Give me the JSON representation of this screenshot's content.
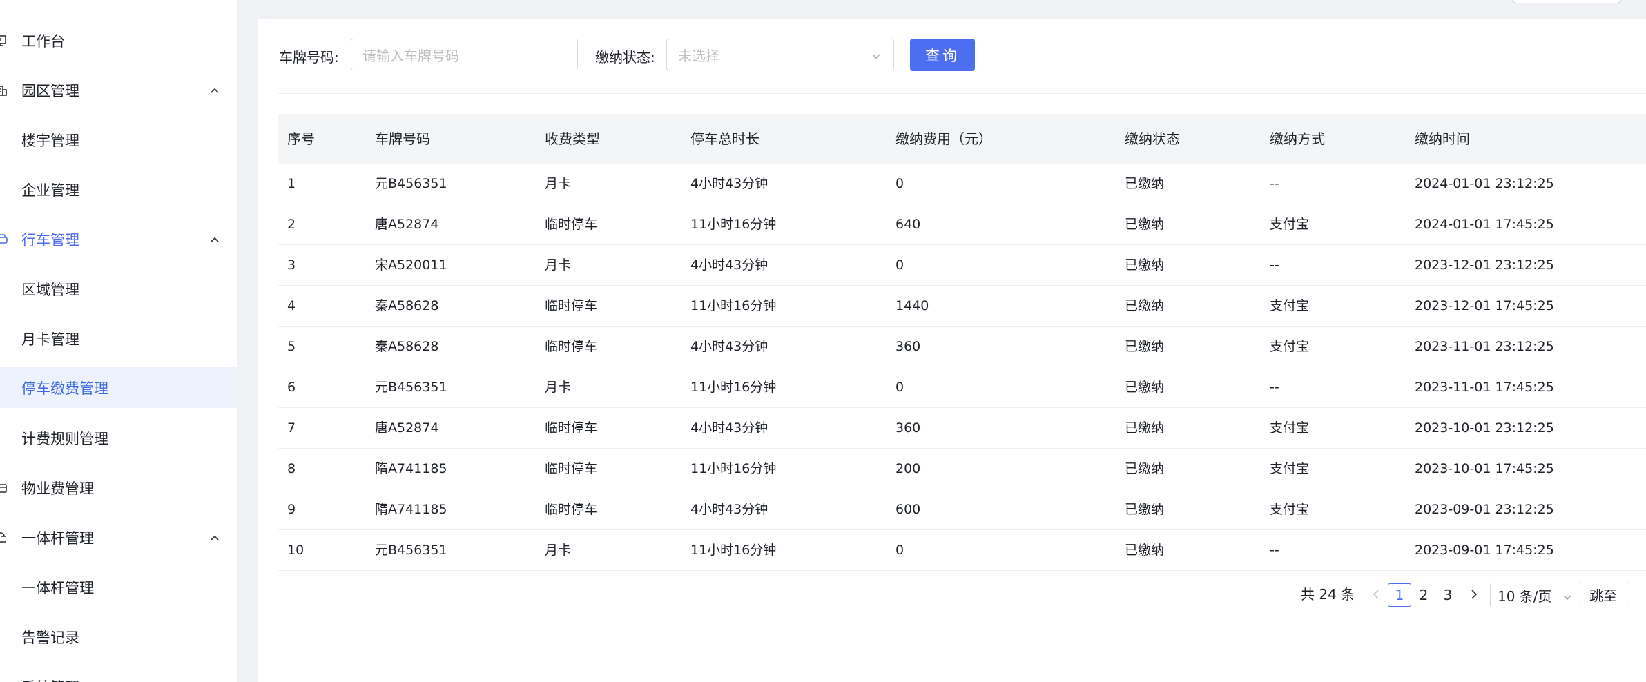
{
  "sidebar": {
    "items": [
      {
        "label": "工作台",
        "icon": "workbench-icon"
      },
      {
        "label": "园区管理",
        "icon": "building-icon",
        "expanded": true
      },
      {
        "label": "楼宇管理"
      },
      {
        "label": "企业管理"
      },
      {
        "label": "行车管理",
        "icon": "car-icon",
        "expanded": true,
        "active": true
      },
      {
        "label": "区域管理"
      },
      {
        "label": "月卡管理"
      },
      {
        "label": "停车缴费管理",
        "selected": true
      },
      {
        "label": "计费规则管理"
      },
      {
        "label": "物业费管理",
        "icon": "property-fee-icon"
      },
      {
        "label": "一体杆管理",
        "icon": "barrier-gate-icon",
        "expanded": true
      },
      {
        "label": "一体杆管理"
      },
      {
        "label": "告警记录"
      },
      {
        "label": "系统管理",
        "icon": "system-icon"
      }
    ],
    "accent_color": "#4e6ef2",
    "selected_bg": "#eef2fd"
  },
  "search": {
    "plate_label": "车牌号码:",
    "plate_placeholder": "请输入车牌号码",
    "status_label": "缴纳状态:",
    "status_placeholder": "未选择",
    "query_button": "查询"
  },
  "table": {
    "headers": [
      "序号",
      "车牌号码",
      "收费类型",
      "停车总时长",
      "缴纳费用（元）",
      "缴纳状态",
      "缴纳方式",
      "缴纳时间"
    ],
    "rows": [
      [
        "1",
        "元B456351",
        "月卡",
        "4小时43分钟",
        "0",
        "已缴纳",
        "--",
        "2024-01-01 23:12:25"
      ],
      [
        "2",
        "唐A52874",
        "临时停车",
        "11小时16分钟",
        "640",
        "已缴纳",
        "支付宝",
        "2024-01-01 17:45:25"
      ],
      [
        "3",
        "宋A520011",
        "月卡",
        "4小时43分钟",
        "0",
        "已缴纳",
        "--",
        "2023-12-01 23:12:25"
      ],
      [
        "4",
        "秦A58628",
        "临时停车",
        "11小时16分钟",
        "1440",
        "已缴纳",
        "支付宝",
        "2023-12-01 17:45:25"
      ],
      [
        "5",
        "秦A58628",
        "临时停车",
        "4小时43分钟",
        "360",
        "已缴纳",
        "支付宝",
        "2023-11-01 23:12:25"
      ],
      [
        "6",
        "元B456351",
        "月卡",
        "11小时16分钟",
        "0",
        "已缴纳",
        "--",
        "2023-11-01 17:45:25"
      ],
      [
        "7",
        "唐A52874",
        "临时停车",
        "4小时43分钟",
        "360",
        "已缴纳",
        "支付宝",
        "2023-10-01 23:12:25"
      ],
      [
        "8",
        "隋A741185",
        "临时停车",
        "11小时16分钟",
        "200",
        "已缴纳",
        "支付宝",
        "2023-10-01 17:45:25"
      ],
      [
        "9",
        "隋A741185",
        "临时停车",
        "4小时43分钟",
        "600",
        "已缴纳",
        "支付宝",
        "2023-09-01 23:12:25"
      ],
      [
        "10",
        "元B456351",
        "月卡",
        "11小时16分钟",
        "0",
        "已缴纳",
        "--",
        "2023-09-01 17:45:25"
      ]
    ]
  },
  "pagination": {
    "total": "共 24 条",
    "pages": [
      "1",
      "2",
      "3"
    ],
    "current": "1",
    "page_size": "10 条/页",
    "jump_label": "跳至"
  }
}
